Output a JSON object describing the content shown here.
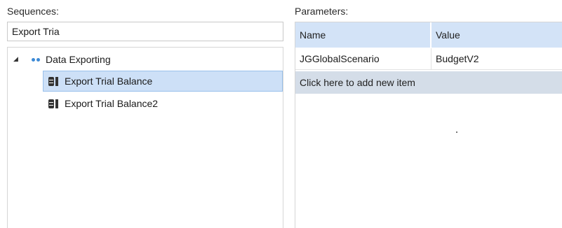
{
  "sequences": {
    "label": "Sequences:",
    "search_value": "Export Tria",
    "tree": {
      "root": {
        "label": "Data Exporting",
        "expanded_glyph": "◢"
      },
      "children": [
        {
          "label": "Export Trial Balance",
          "selected": true
        },
        {
          "label": "Export Trial Balance2",
          "selected": false
        }
      ]
    }
  },
  "parameters": {
    "label": "Parameters:",
    "columns": [
      "Name",
      "Value"
    ],
    "rows": [
      {
        "name": "JGGlobalScenario",
        "value": "BudgetV2"
      }
    ],
    "add_row_label": "Click here to add new item"
  },
  "colors": {
    "selection_bg": "#cde0f7",
    "selection_border": "#99c1ec",
    "header_bg": "#d3e3f7",
    "add_row_bg": "#d4dde8",
    "folder_dots": "#3d8ad6"
  },
  "icons": {
    "tree_root": "category-dots-icon",
    "tree_item": "procedure-icon",
    "expander": "expand-triangle-icon"
  }
}
